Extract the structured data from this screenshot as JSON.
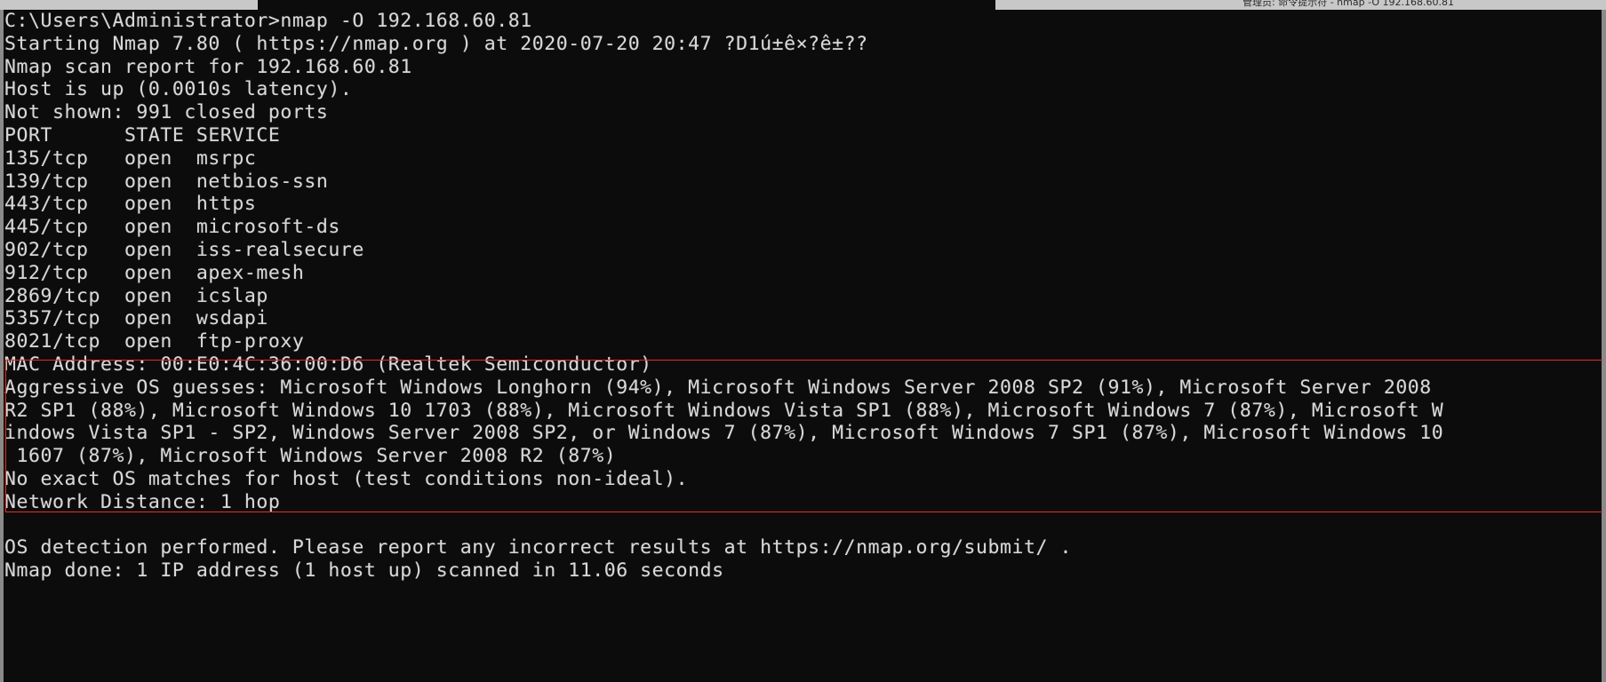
{
  "window": {
    "title_strip_text": "管理员: 命令提示符 - nmap  -O  192.168.60.81",
    "background_color": "#0c0c0c",
    "text_color": "#d8d8d8",
    "annotation_color": "#ef2a21"
  },
  "terminal": {
    "prompt": "C:\\Users\\Administrator>",
    "command": "nmap -O 192.168.60.81",
    "lines": [
      "C:\\Users\\Administrator>nmap -O 192.168.60.81",
      "Starting Nmap 7.80 ( https://nmap.org ) at 2020-07-20 20:47 ?D1ú±ê×?ê±??",
      "Nmap scan report for 192.168.60.81",
      "Host is up (0.0010s latency).",
      "Not shown: 991 closed ports",
      "PORT      STATE SERVICE",
      "135/tcp   open  msrpc",
      "139/tcp   open  netbios-ssn",
      "443/tcp   open  https",
      "445/tcp   open  microsoft-ds",
      "902/tcp   open  iss-realsecure",
      "912/tcp   open  apex-mesh",
      "2869/tcp  open  icslap",
      "5357/tcp  open  wsdapi",
      "8021/tcp  open  ftp-proxy",
      "MAC Address: 00:E0:4C:36:00:D6 (Realtek Semiconductor)",
      "Aggressive OS guesses: Microsoft Windows Longhorn (94%), Microsoft Windows Server 2008 SP2 (91%), Microsoft Server 2008",
      "R2 SP1 (88%), Microsoft Windows 10 1703 (88%), Microsoft Windows Vista SP1 (88%), Microsoft Windows 7 (87%), Microsoft W",
      "indows Vista SP1 - SP2, Windows Server 2008 SP2, or Windows 7 (87%), Microsoft Windows 7 SP1 (87%), Microsoft Windows 10",
      " 1607 (87%), Microsoft Windows Server 2008 R2 (87%)",
      "No exact OS matches for host (test conditions non-ideal).",
      "Network Distance: 1 hop",
      "",
      "OS detection performed. Please report any incorrect results at https://nmap.org/submit/ .",
      "Nmap done: 1 IP address (1 host up) scanned in 11.06 seconds"
    ]
  },
  "scan": {
    "tool": "Nmap",
    "version": "7.80",
    "url": "https://nmap.org",
    "submit_url": "https://nmap.org/submit/",
    "started_at": "2020-07-20 20:47",
    "target_ip": "192.168.60.81",
    "host_status": "up",
    "latency": "0.0010s",
    "not_shown": "991 closed ports",
    "mac_address": "00:E0:4C:36:00:D6",
    "mac_vendor": "Realtek Semiconductor",
    "network_distance": "1 hop",
    "os_match_note": "No exact OS matches for host (test conditions non-ideal).",
    "detection_note": "OS detection performed. Please report any incorrect results at https://nmap.org/submit/ .",
    "summary": "Nmap done: 1 IP address (1 host up) scanned in 11.06 seconds",
    "ip_count": "1",
    "hosts_up": "1",
    "elapsed_seconds": "11.06",
    "ports": {
      "headers": [
        "PORT",
        "STATE",
        "SERVICE"
      ],
      "rows": [
        [
          "135/tcp",
          "open",
          "msrpc"
        ],
        [
          "139/tcp",
          "open",
          "netbios-ssn"
        ],
        [
          "443/tcp",
          "open",
          "https"
        ],
        [
          "445/tcp",
          "open",
          "microsoft-ds"
        ],
        [
          "902/tcp",
          "open",
          "iss-realsecure"
        ],
        [
          "912/tcp",
          "open",
          "apex-mesh"
        ],
        [
          "2869/tcp",
          "open",
          "icslap"
        ],
        [
          "5357/tcp",
          "open",
          "wsdapi"
        ],
        [
          "8021/tcp",
          "open",
          "ftp-proxy"
        ]
      ]
    },
    "os_guesses": [
      {
        "name": "Microsoft Windows Longhorn",
        "confidence": "94%"
      },
      {
        "name": "Microsoft Windows Server 2008 SP2",
        "confidence": "91%"
      },
      {
        "name": "Microsoft Server 2008 R2 SP1",
        "confidence": "88%"
      },
      {
        "name": "Microsoft Windows 10 1703",
        "confidence": "88%"
      },
      {
        "name": "Microsoft Windows Vista SP1",
        "confidence": "88%"
      },
      {
        "name": "Microsoft Windows 7",
        "confidence": "87%"
      },
      {
        "name": "Microsoft Windows Vista SP1 - SP2, Windows Server 2008 SP2, or Windows 7",
        "confidence": "87%"
      },
      {
        "name": "Microsoft Windows 7 SP1",
        "confidence": "87%"
      },
      {
        "name": "Microsoft Windows 10 1607",
        "confidence": "87%"
      },
      {
        "name": "Microsoft Windows Server 2008 R2",
        "confidence": "87%"
      }
    ]
  }
}
